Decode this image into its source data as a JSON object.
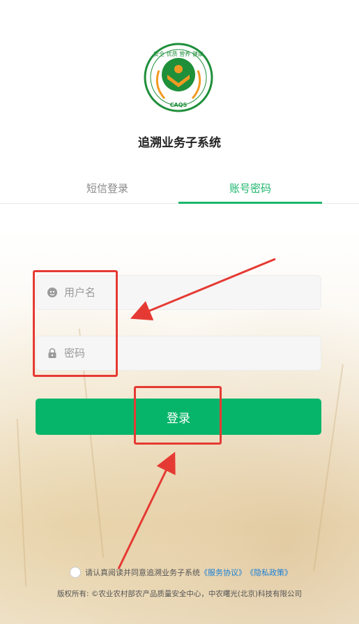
{
  "app": {
    "logo_text_top": "安全 优质 营养 健康",
    "logo_text_bottom": "CAQS",
    "title": "追溯业务子系统"
  },
  "tabs": [
    {
      "label": "短信登录",
      "active": false
    },
    {
      "label": "账号密码",
      "active": true
    }
  ],
  "form": {
    "username_placeholder": "用户名",
    "password_placeholder": "密码",
    "login_label": "登录"
  },
  "agreement": {
    "prefix": "请认真阅读并同意追溯业务子系统",
    "service_link": "《服务协议》",
    "privacy_link": "《隐私政策》",
    "checked": false
  },
  "footer": {
    "copyright": "版权所有: ©农业农村部农产品质量安全中心，中农曙光(北京)科技有限公司"
  },
  "colors": {
    "accent": "#07b56a",
    "tab_active": "#1cb56b",
    "link": "#1a7fd6",
    "annotation": "#e53a33",
    "logo_green": "#1f8f3a",
    "logo_orange": "#f29a22"
  },
  "icons": {
    "user": "user-icon",
    "lock": "lock-icon"
  }
}
